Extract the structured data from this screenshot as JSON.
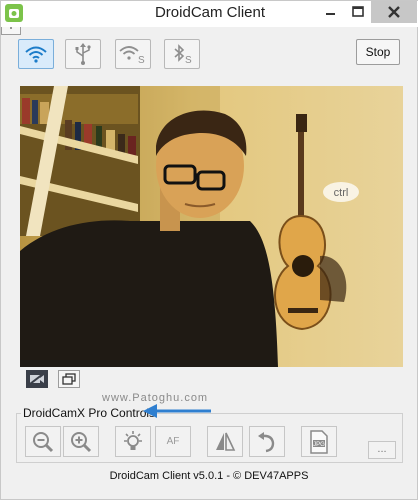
{
  "window": {
    "title": "DroidCam Client"
  },
  "titlebar_buttons": {
    "minimize_icon": "minimize-icon",
    "maximize_icon": "maximize-icon",
    "close_icon": "close-icon"
  },
  "connection_modes": [
    {
      "name": "wifi",
      "icon": "wifi-icon",
      "active": true
    },
    {
      "name": "usb",
      "icon": "usb-icon",
      "active": false
    },
    {
      "name": "wifi-server",
      "icon": "wifi-server-icon",
      "active": false
    },
    {
      "name": "bluetooth-server",
      "icon": "bluetooth-server-icon",
      "active": false
    }
  ],
  "stop_label": "Stop",
  "preview": {
    "overlay_text": "ctrl"
  },
  "zoom": {
    "minus_label": "-",
    "plus_label": "+"
  },
  "watermark": "www.Patoghu.com",
  "pro_controls": {
    "label": "DroidCamX Pro Controls",
    "af_label": "AF",
    "more_label": "...",
    "buttons": [
      "zoom-out-icon",
      "zoom-in-icon",
      "light-icon",
      "autofocus",
      "mirror-icon",
      "rotate-icon",
      "jpg-icon"
    ]
  },
  "footer": "DroidCam Client v5.0.1 - © DEV47APPS",
  "colors": {
    "accent": "#1c7cc9",
    "active_button": "#d9ebfb",
    "app_icon": "#7cc34a",
    "arrow": "#2f7fd0"
  }
}
